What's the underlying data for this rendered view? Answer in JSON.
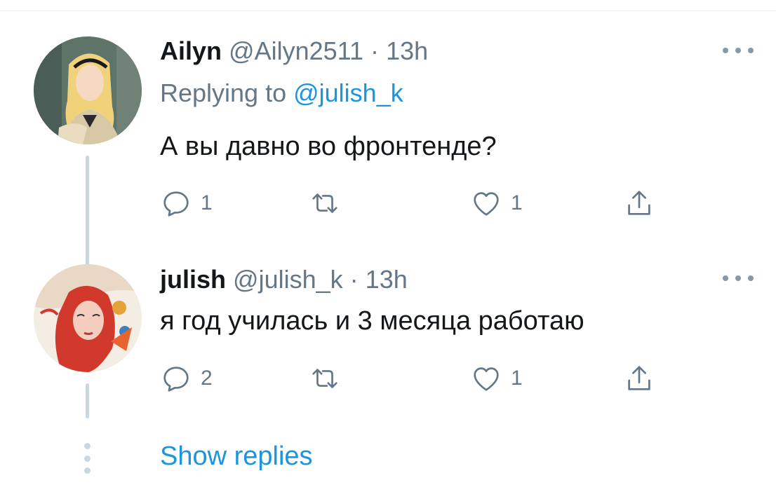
{
  "tweets": [
    {
      "name": "Ailyn",
      "handle": "@Ailyn2511",
      "time": "13h",
      "replying_prefix": "Replying to ",
      "replying_handle": "@julish_k",
      "text": "А вы давно во фронтенде?",
      "reply_count": "1",
      "retweet_count": "",
      "like_count": "1"
    },
    {
      "name": "julish",
      "handle": "@julish_k",
      "time": "13h",
      "text": "я год училась и 3 месяца работаю",
      "reply_count": "2",
      "retweet_count": "",
      "like_count": "1"
    }
  ],
  "separator": "·",
  "show_replies": "Show replies",
  "colors": {
    "accent": "#1b95e0",
    "secondary_text": "#657786",
    "primary_text": "#14171a",
    "thread_line": "#ccd6dd"
  },
  "icons": [
    "more-icon",
    "reply-icon",
    "retweet-icon",
    "like-icon",
    "share-icon",
    "thread-dots-icon"
  ]
}
